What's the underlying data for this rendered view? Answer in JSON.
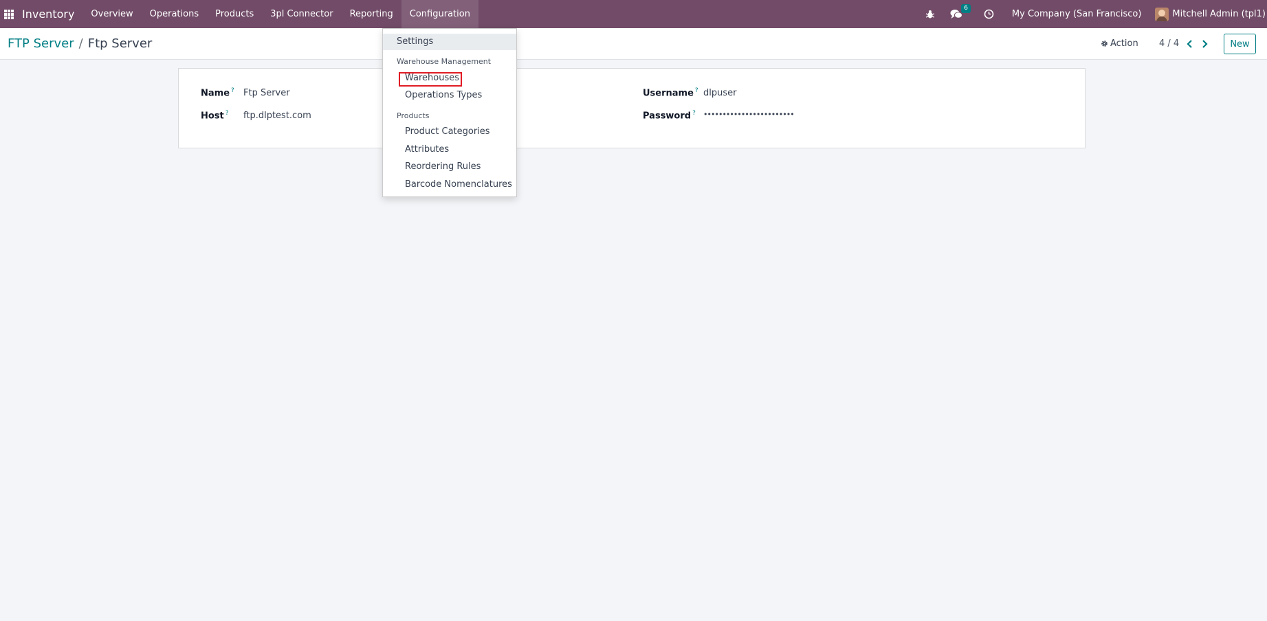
{
  "navbar": {
    "brand": "Inventory",
    "menu": [
      "Overview",
      "Operations",
      "Products",
      "3pl Connector",
      "Reporting",
      "Configuration"
    ],
    "active_menu": "Configuration",
    "messages_badge": "6",
    "company": "My Company (San Francisco)",
    "user": "Mitchell Admin (tpl1)",
    "accent_color": "#714b67"
  },
  "breadcrumb": {
    "parent": "FTP Server",
    "separator": "/",
    "current": "Ftp Server"
  },
  "control": {
    "action_label": "Action",
    "pager": "4 / 4",
    "new_label": "New"
  },
  "form": {
    "name_label": "Name",
    "name_value": "Ftp Server",
    "host_label": "Host",
    "host_value": "ftp.dlptest.com",
    "username_label": "Username",
    "username_value": "dlpuser",
    "password_label": "Password",
    "password_value": "••••••••••••••••••••••••",
    "help_mark": "?"
  },
  "dropdown": {
    "settings": "Settings",
    "section_warehouse": "Warehouse Management",
    "warehouses": "Warehouses",
    "operations_types": "Operations Types",
    "section_products": "Products",
    "product_categories": "Product Categories",
    "attributes": "Attributes",
    "reordering_rules": "Reordering Rules",
    "barcode_nomenclatures": "Barcode Nomenclatures"
  }
}
